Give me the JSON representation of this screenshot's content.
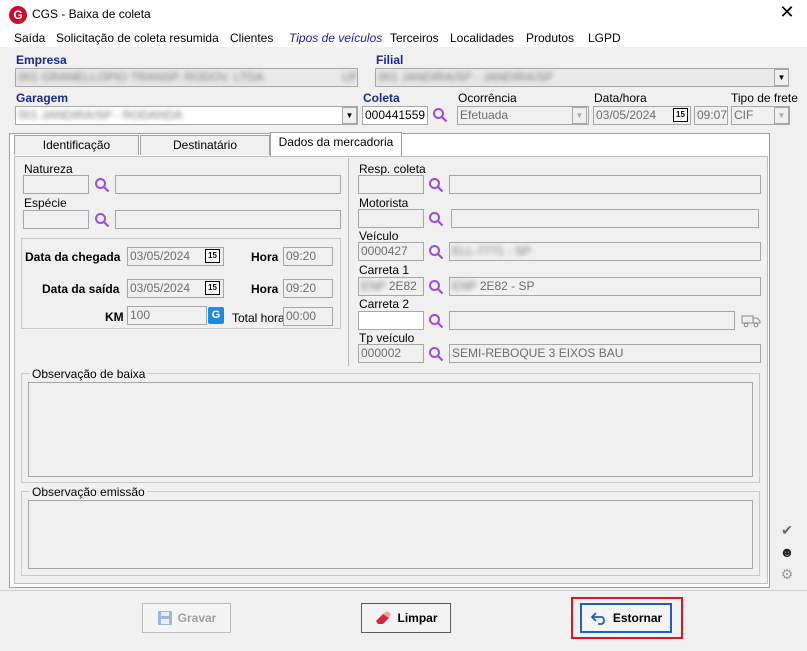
{
  "window": {
    "logo": "G",
    "title": "CGS - Baixa de coleta",
    "close": "✕"
  },
  "menu": [
    "Saída",
    "Solicitação de coleta resumida",
    "Clientes",
    "Tipos de veículos",
    "Terceiros",
    "Localidades",
    "Produtos",
    "LGPD"
  ],
  "header": {
    "empresa_label": "Empresa",
    "empresa_value": "001 GRANELLOPIO TRANSP. RODOV. LTDA",
    "empresa_suffix": "UF 14",
    "filial_label": "Filial",
    "filial_value": "001 JANDIRA/SP - JANDIRA/SP",
    "garagem_label": "Garagem",
    "garagem_value": "001 JANDIRA/SP - RODANDA",
    "coleta_label": "Coleta",
    "coleta_value": "000441559",
    "ocorrencia_label": "Ocorrência",
    "ocorrencia_value": "Efetuada",
    "datahora_label": "Data/hora",
    "data_value": "03/05/2024",
    "hora_value": "09:07",
    "frete_label": "Tipo de frete",
    "frete_value": "CIF"
  },
  "tabs": [
    "Identificação",
    "Destinatário",
    "Dados da mercadoria"
  ],
  "left": {
    "natureza_label": "Natureza",
    "especie_label": "Espécie",
    "chegada_label": "Data da chegada",
    "chegada_date": "03/05/2024",
    "saida_label": "Data da saída",
    "saida_date": "03/05/2024",
    "hora_label": "Hora",
    "chegada_hora": "09:20",
    "saida_hora": "09:20",
    "km_label": "KM",
    "km_value": "100",
    "total_hora_label": "Total hora",
    "total_hora_value": "00:00"
  },
  "right": {
    "resp_label": "Resp. coleta",
    "motorista_label": "Motorista",
    "veiculo_label": "Veículo",
    "veiculo_code": "0000427",
    "veiculo_desc": "ELL-7771 - SP",
    "carreta1_label": "Carreta 1",
    "carreta1_code": "2E82",
    "carreta1_code_blur": "ENP",
    "carreta1_desc": "2E82 - SP",
    "carreta1_desc_blur": "ENP",
    "carreta2_label": "Carreta 2",
    "tpveiculo_label": "Tp veículo",
    "tpveiculo_code": "000002",
    "tpveiculo_desc": "SEMI-REBOQUE 3 EIXOS BAU"
  },
  "obs": {
    "baixa_label": "Observação de baixa",
    "emissao_label": "Observação emissão"
  },
  "buttons": {
    "gravar": "Gravar",
    "limpar": "Limpar",
    "estornar": "Estornar"
  },
  "colors": {
    "highlight": "#e0141e",
    "accent": "#1a2a8a",
    "search": "#9b4fd8"
  }
}
